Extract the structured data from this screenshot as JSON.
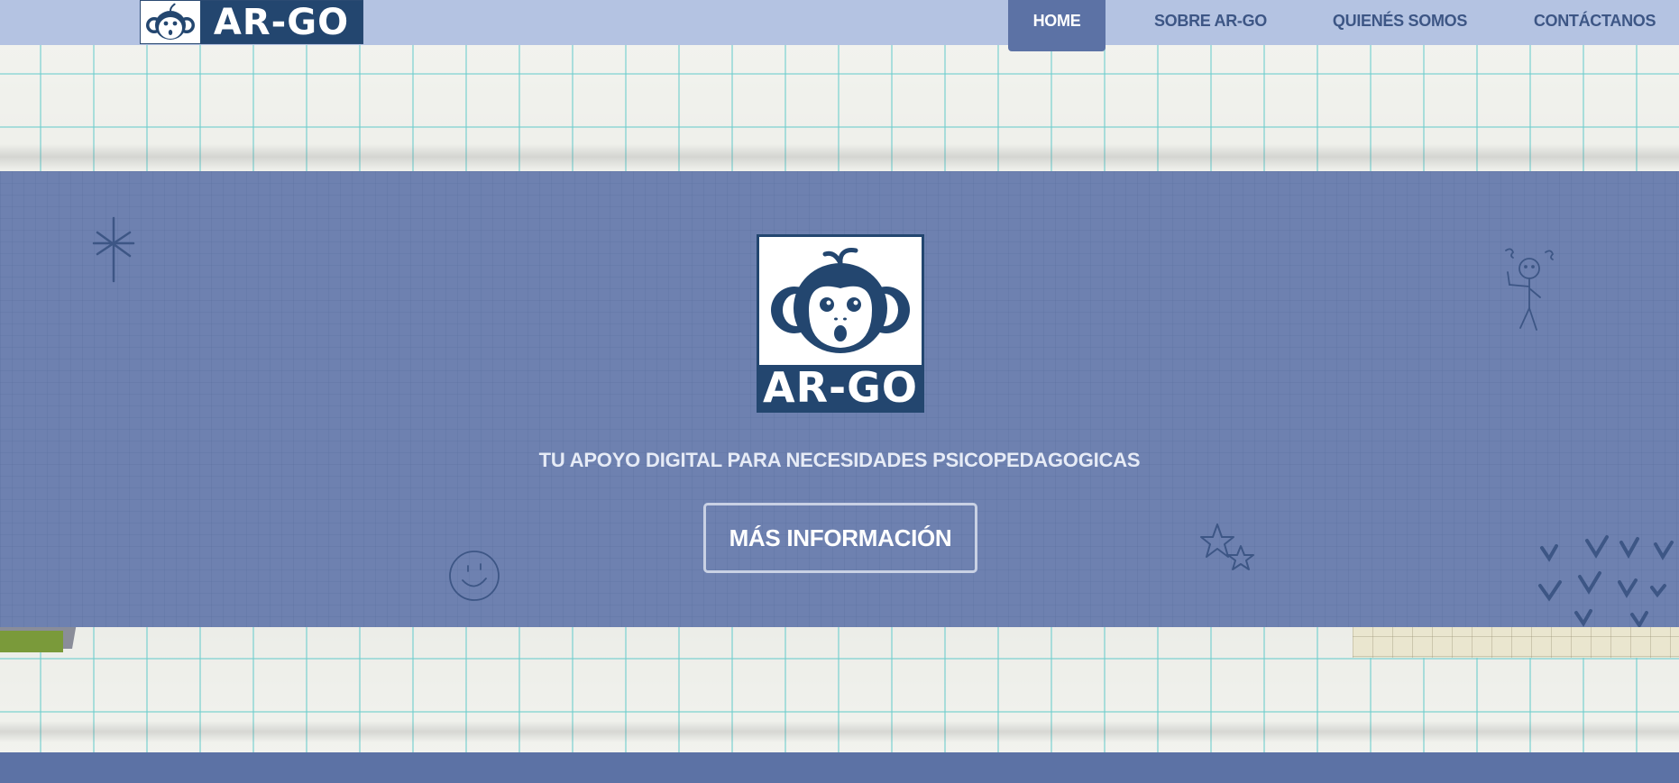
{
  "brand": {
    "name": "AR-GO",
    "logo_icon": "monkey-face-icon"
  },
  "nav": {
    "items": [
      {
        "label": "HOME",
        "active": true
      },
      {
        "label": "SOBRE AR-GO",
        "active": false
      },
      {
        "label": "QUIENÉS SOMOS",
        "active": false
      },
      {
        "label": "CONTÁCTANOS",
        "active": false
      }
    ]
  },
  "hero": {
    "logo_text": "AR-GO",
    "tagline": "TU APOYO DIGITAL PARA NECESIDADES PSICOPEDAGOGICAS",
    "cta_label": "MÁS INFORMACIÓN"
  },
  "colors": {
    "header_bg": "#b4c3e2",
    "nav_active_bg": "#5c72a5",
    "brand_navy": "#23466f",
    "hero_bg": "#6e81b0",
    "grid_line": "#6ecdcd"
  },
  "decorations": [
    "asterisk-doodle",
    "stick-figure-doodle",
    "smiley-doodle",
    "stars-doodle",
    "checkmarks-doodle"
  ]
}
